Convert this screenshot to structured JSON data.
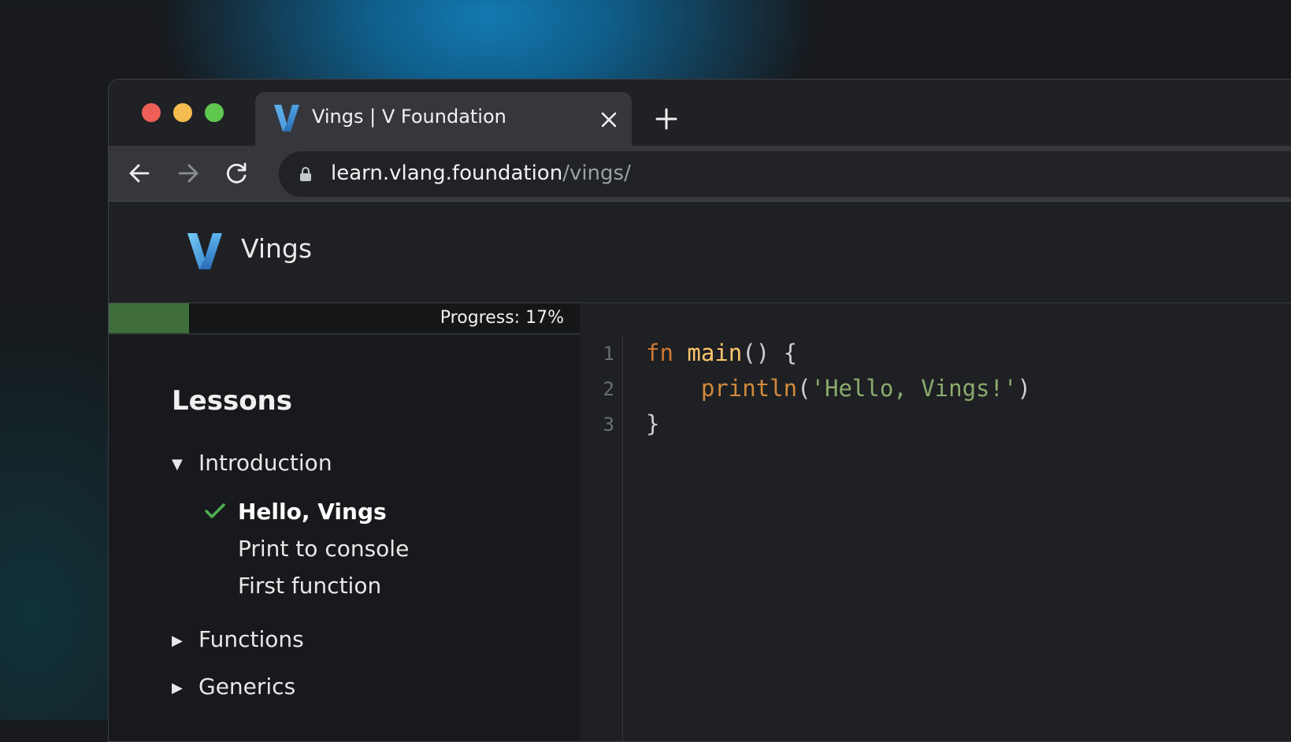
{
  "browser": {
    "tab_title": "Vings | V Foundation",
    "url_host": "learn.vlang.foundation",
    "url_path": "/vings/"
  },
  "header": {
    "brand_name": "Vings"
  },
  "sidebar": {
    "progress_label": "Progress: 17%",
    "progress_percent": 17,
    "lessons_title": "Lessons",
    "sections": [
      {
        "label": "Introduction",
        "expanded": true,
        "lessons": [
          {
            "label": "Hello, Vings",
            "completed": true,
            "active": true
          },
          {
            "label": "Print to console",
            "completed": false,
            "active": false
          },
          {
            "label": "First function",
            "completed": false,
            "active": false
          }
        ]
      },
      {
        "label": "Functions",
        "expanded": false
      },
      {
        "label": "Generics",
        "expanded": false
      }
    ]
  },
  "editor": {
    "line_numbers": [
      "1",
      "2",
      "3"
    ],
    "lines": [
      {
        "tokens": [
          {
            "text": "fn",
            "cls": "kw"
          },
          {
            "text": " ",
            "cls": "punc"
          },
          {
            "text": "main",
            "cls": "fn"
          },
          {
            "text": "() {",
            "cls": "punc"
          }
        ]
      },
      {
        "tokens": [
          {
            "text": "    ",
            "cls": "punc"
          },
          {
            "text": "println",
            "cls": "builtin"
          },
          {
            "text": "(",
            "cls": "punc"
          },
          {
            "text": "'Hello, Vings!'",
            "cls": "str"
          },
          {
            "text": ")",
            "cls": "punc"
          }
        ]
      },
      {
        "tokens": [
          {
            "text": "}",
            "cls": "punc"
          }
        ]
      }
    ]
  },
  "colors": {
    "progress_fill": "#3f6d3c",
    "check": "#4caf50",
    "keyword": "#cc7832",
    "function": "#ffc66d",
    "string": "#8bab6d"
  },
  "icons": {
    "tab_favicon": "v-logo-icon",
    "tab_close": "close-icon",
    "new_tab": "plus-icon",
    "back": "arrow-left-icon",
    "forward": "arrow-right-icon",
    "reload": "reload-icon",
    "lock": "lock-icon",
    "expanded_caret": "caret-down-icon",
    "collapsed_caret": "caret-right-icon",
    "completed": "check-icon"
  }
}
